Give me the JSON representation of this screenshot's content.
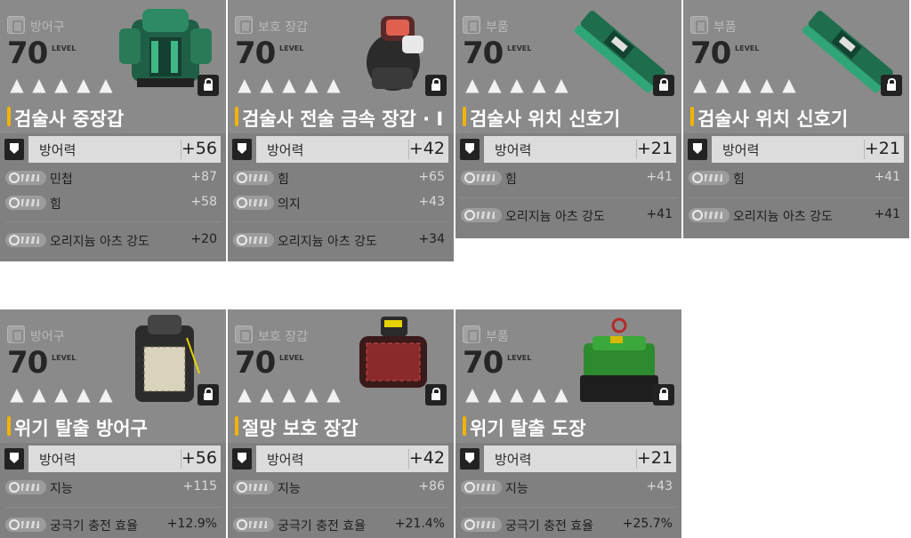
{
  "level_label": "LEVEL",
  "colors": {
    "name_accent": "#f2b400",
    "lock": "#222222",
    "card": "#808080"
  },
  "cards": [
    {
      "category": "방어구",
      "level": "70",
      "name": "검술사 중장갑",
      "defense_label": "방어력",
      "defense": "+56",
      "stats": [
        {
          "label": "민첩",
          "value": "+87"
        },
        {
          "label": "힘",
          "value": "+58"
        },
        {
          "label": "오리지늄 아츠 강도",
          "value": "+20"
        }
      ],
      "locked": true,
      "image": "green-armor"
    },
    {
      "category": "보호 장갑",
      "level": "70",
      "name": "검술사 전술 금속 장갑 · I",
      "defense_label": "방어력",
      "defense": "+42",
      "stats": [
        {
          "label": "힘",
          "value": "+65"
        },
        {
          "label": "의지",
          "value": "+43"
        },
        {
          "label": "오리지늄 아츠 강도",
          "value": "+34"
        }
      ],
      "locked": true,
      "image": "gauntlet"
    },
    {
      "category": "부품",
      "level": "70",
      "name": "검술사 위치 신호기",
      "defense_label": "방어력",
      "defense": "+21",
      "stats": [
        {
          "label": "힘",
          "value": "+41"
        },
        {
          "label": "오리지늄 아츠 강도",
          "value": "+41"
        }
      ],
      "locked": true,
      "image": "beacon"
    },
    {
      "category": "부품",
      "level": "70",
      "name": "검술사 위치 신호기",
      "defense_label": "방어력",
      "defense": "+21",
      "stats": [
        {
          "label": "힘",
          "value": "+41"
        },
        {
          "label": "오리지늄 아츠 강도",
          "value": "+41"
        }
      ],
      "locked": true,
      "image": "beacon"
    },
    {
      "category": "방어구",
      "level": "70",
      "name": "위기 탈출 방어구",
      "defense_label": "방어력",
      "defense": "+56",
      "stats": [
        {
          "label": "지능",
          "value": "+115"
        },
        {
          "label": "궁극기 충전 효율",
          "value": "+12.9%"
        }
      ],
      "locked": true,
      "image": "vest"
    },
    {
      "category": "보호 장갑",
      "level": "70",
      "name": "절망 보호 장갑",
      "defense_label": "방어력",
      "defense": "+42",
      "stats": [
        {
          "label": "지능",
          "value": "+86"
        },
        {
          "label": "궁극기 충전 효율",
          "value": "+21.4%"
        }
      ],
      "locked": true,
      "image": "red-gauntlet"
    },
    {
      "category": "부품",
      "level": "70",
      "name": "위기 탈출 도장",
      "defense_label": "방어력",
      "defense": "+21",
      "stats": [
        {
          "label": "지능",
          "value": "+43"
        },
        {
          "label": "궁극기 충전 효율",
          "value": "+25.7%"
        }
      ],
      "locked": true,
      "image": "seal"
    }
  ]
}
